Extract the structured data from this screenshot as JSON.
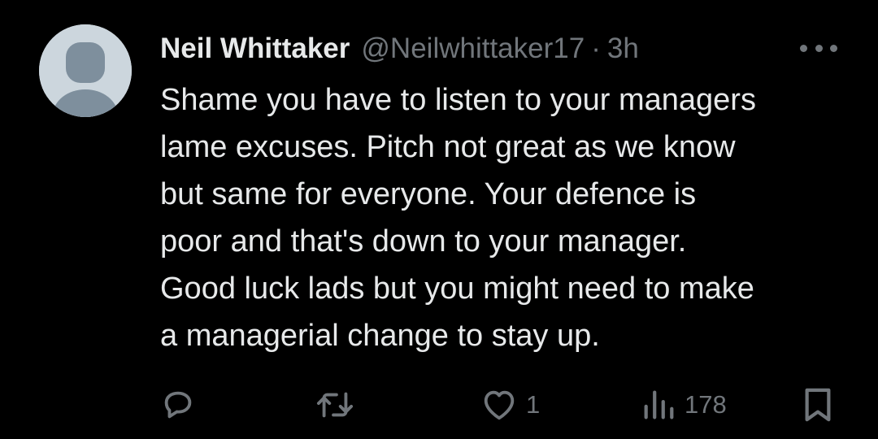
{
  "tweet": {
    "author_name": "Neil Whittaker",
    "handle": "@Neilwhittaker17",
    "separator": "·",
    "time": "3h",
    "text": "Shame you have to listen to your managers\nlame excuses. Pitch not great as we know\nbut same for everyone. Your defence is\npoor and that's down to your manager.\nGood luck lads but you might need to make\na managerial change to stay up."
  },
  "actions": {
    "likes": "1",
    "views": "178"
  },
  "icons": {
    "avatar": "default-avatar-icon",
    "more": "more-options-icon",
    "reply": "reply-icon",
    "retweet": "retweet-icon",
    "like": "heart-icon",
    "views": "views-chart-icon",
    "bookmark": "bookmark-icon"
  },
  "colors": {
    "background": "#000000",
    "primary_text": "#e7e9ea",
    "secondary_text": "#71767b",
    "avatar_bg": "#ccd6dd",
    "avatar_fg": "#7e8f9d"
  }
}
